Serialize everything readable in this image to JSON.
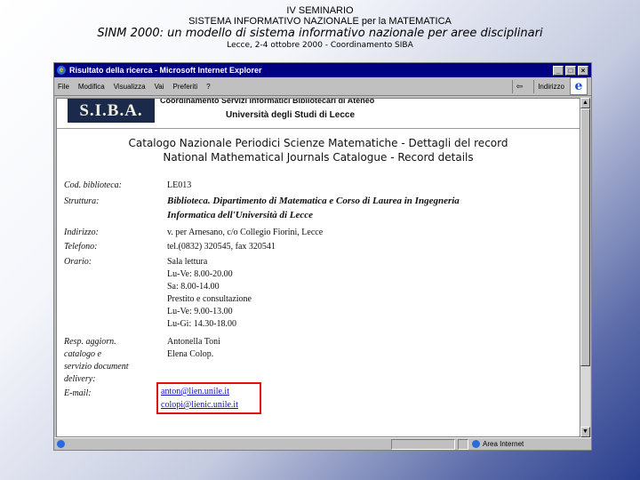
{
  "slide": {
    "line1": "IV SEMINARIO",
    "line2": "SISTEMA INFORMATIVO NAZIONALE per la MATEMATICA",
    "line3": "SINM 2000: un modello di sistema informativo nazionale per aree disciplinari",
    "line4": "Lecce, 2-4 ottobre 2000 - Coordinamento SIBA"
  },
  "window": {
    "title": "Risultato della ricerca - Microsoft Internet Explorer",
    "controls": [
      "_",
      "□",
      "×"
    ]
  },
  "menu": {
    "items": [
      "File",
      "Modifica",
      "Visualizza",
      "Vai",
      "Preferiti",
      "?"
    ],
    "address_label": "Indirizzo"
  },
  "page": {
    "logo_text": "S.I.B.A.",
    "header_line1": "Coordinamento Servizi Informatici Bibliotecari di Ateneo",
    "header_line2": "Università degli Studi di Lecce",
    "catalog_it": "Catalogo Nazionale Periodici Scienze Matematiche - Dettagli del record",
    "catalog_en": "National Mathematical Journals Catalogue - Record details",
    "record": {
      "cod_label": "Cod. biblioteca:",
      "cod_value": "LE013",
      "struttura_label": "Struttura:",
      "struttura_value_1": "Biblioteca. Dipartimento di Matematica e Corso di Laurea in Ingegneria",
      "struttura_value_2": "Informatica dell'Università di Lecce",
      "indirizzo_label": "Indirizzo:",
      "indirizzo_value": "v. per Arnesano, c/o Collegio Fiorini, Lecce",
      "telefono_label": "Telefono:",
      "telefono_value": "tel.(0832) 320545, fax 320541",
      "orario_label": "Orario:",
      "orario_lines": [
        "Sala lettura",
        "Lu-Ve: 8.00-20.00",
        "Sa: 8.00-14.00",
        "Prestito e consultazione",
        "Lu-Ve: 9.00-13.00",
        "Lu-Gi: 14.30-18.00"
      ],
      "resp_label_lines": [
        "Resp. aggiorn.",
        "catalogo e",
        "servizio document",
        "delivery:"
      ],
      "resp_values": [
        "Antonella Toni",
        "Elena Colop."
      ],
      "email_label": "E-mail:",
      "emails": [
        "anton@lien.unile.it",
        "colopi@lienic.unile.it"
      ]
    }
  },
  "status": {
    "zone_label": "Area Internet"
  }
}
